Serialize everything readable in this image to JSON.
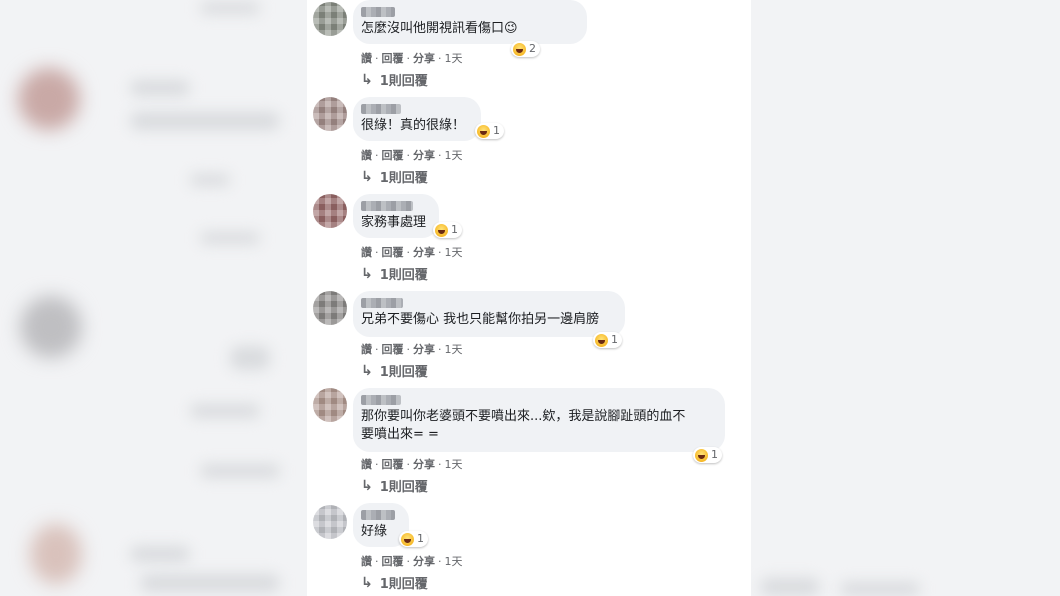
{
  "actions": {
    "like": "讚",
    "reply": "回覆",
    "share": "分享",
    "sep": "·"
  },
  "comments": [
    {
      "text": "怎麼沒叫他開視訊看傷口",
      "emoji": "😉",
      "reaction_count": "2",
      "time": "1天",
      "replies": "1則回覆"
    },
    {
      "text": "很綠！真的很綠！",
      "reaction_count": "1",
      "time": "1天",
      "replies": "1則回覆"
    },
    {
      "text": "家務事處理",
      "reaction_count": "1",
      "time": "1天",
      "replies": "1則回覆"
    },
    {
      "text": "兄弟不要傷心 我也只能幫你拍另一邊肩膀",
      "reaction_count": "1",
      "time": "1天",
      "replies": "1則回覆"
    },
    {
      "text": "那你要叫你老婆頭不要噴出來...欸，我是說腳趾頭的血不\n要噴出來= =",
      "reaction_count": "1",
      "time": "1天",
      "replies": "1則回覆"
    },
    {
      "text": "好綠",
      "reaction_count": "1",
      "time": "1天",
      "replies": "1則回覆"
    }
  ],
  "reply_arrow": "↳",
  "reaction_icon": "haha-icon"
}
